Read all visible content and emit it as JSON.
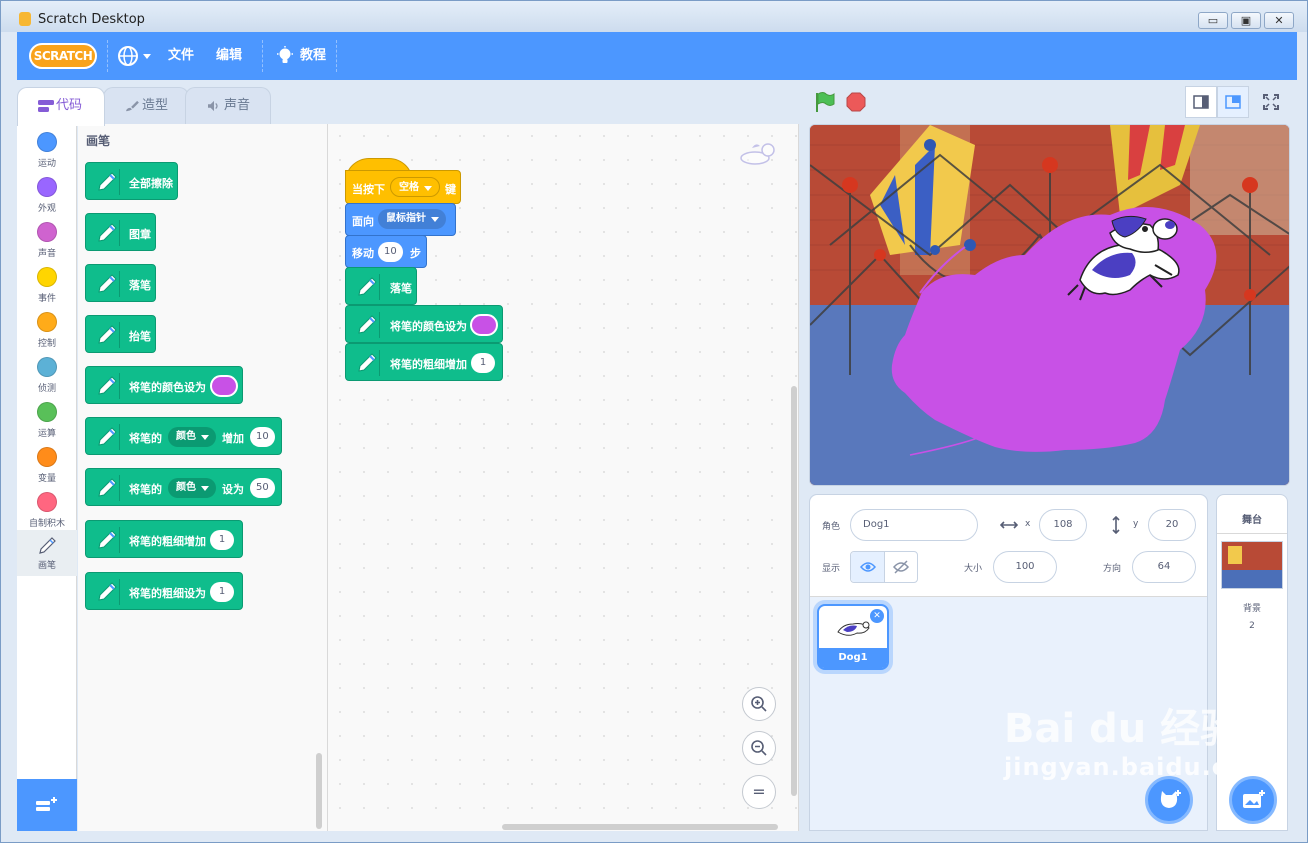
{
  "window": {
    "title": "Scratch Desktop",
    "minimize": "▭",
    "maximize": "▣",
    "close": "✕"
  },
  "menubar": {
    "logo": "SCRATCH",
    "file": "文件",
    "edit": "编辑",
    "tutorials": "教程"
  },
  "tabs": [
    {
      "label": "代码"
    },
    {
      "label": "造型"
    },
    {
      "label": "声音"
    }
  ],
  "categories": [
    {
      "label": "运动",
      "color": "#4c97ff"
    },
    {
      "label": "外观",
      "color": "#9966ff"
    },
    {
      "label": "声音",
      "color": "#cf63cf"
    },
    {
      "label": "事件",
      "color": "#ffd500"
    },
    {
      "label": "控制",
      "color": "#ffab19"
    },
    {
      "label": "侦测",
      "color": "#5cb1d6"
    },
    {
      "label": "运算",
      "color": "#59c059"
    },
    {
      "label": "变量",
      "color": "#ff8c1a"
    },
    {
      "label": "自制积木",
      "color": "#ff6680"
    },
    {
      "label": "画笔",
      "color": "#0fbd8c"
    }
  ],
  "flyout": {
    "title": "画笔",
    "erase_all": "全部擦除",
    "stamp": "图章",
    "pen_down": "落笔",
    "pen_up": "抬笔",
    "set_color": "将笔的颜色设为",
    "change_param_prefix": "将笔的",
    "change_param_dd": "颜色",
    "change_param_mid": "增加",
    "change_param_val": "10",
    "set_param_prefix": "将笔的",
    "set_param_dd": "颜色",
    "set_param_mid": "设为",
    "set_param_val": "50",
    "change_size": "将笔的粗细增加",
    "change_size_val": "1",
    "set_size": "将笔的粗细设为",
    "set_size_val": "1"
  },
  "script": {
    "when_key_prefix": "当按下",
    "when_key_value": "空格",
    "when_key_suffix": "键",
    "point_towards": "面向",
    "point_target": "鼠标指针",
    "move_prefix": "移动",
    "move_steps": "10",
    "move_suffix": "步",
    "pen_down": "落笔",
    "set_color": "将笔的颜色设为",
    "change_size": "将笔的粗细增加",
    "change_size_val": "1"
  },
  "zoom": {
    "in": "+",
    "out": "−",
    "reset": "="
  },
  "sprite_info": {
    "sprite_label": "角色",
    "sprite_name": "Dog1",
    "x_label": "x",
    "x_value": "108",
    "y_label": "y",
    "y_value": "20",
    "show_label": "显示",
    "size_label": "大小",
    "size_value": "100",
    "direction_label": "方向",
    "direction_value": "64"
  },
  "sprites": [
    {
      "name": "Dog1"
    }
  ],
  "stage_pane": {
    "title": "舞台",
    "backdrops_label": "背景",
    "backdrops_count": "2"
  },
  "watermark": {
    "brand": "Bai du 经验",
    "url": "jingyan.baidu.com"
  },
  "colors": {
    "accent": "#4c97ff",
    "pen": "#0fbd8c",
    "pen_color_swatch": "#c851e6"
  }
}
